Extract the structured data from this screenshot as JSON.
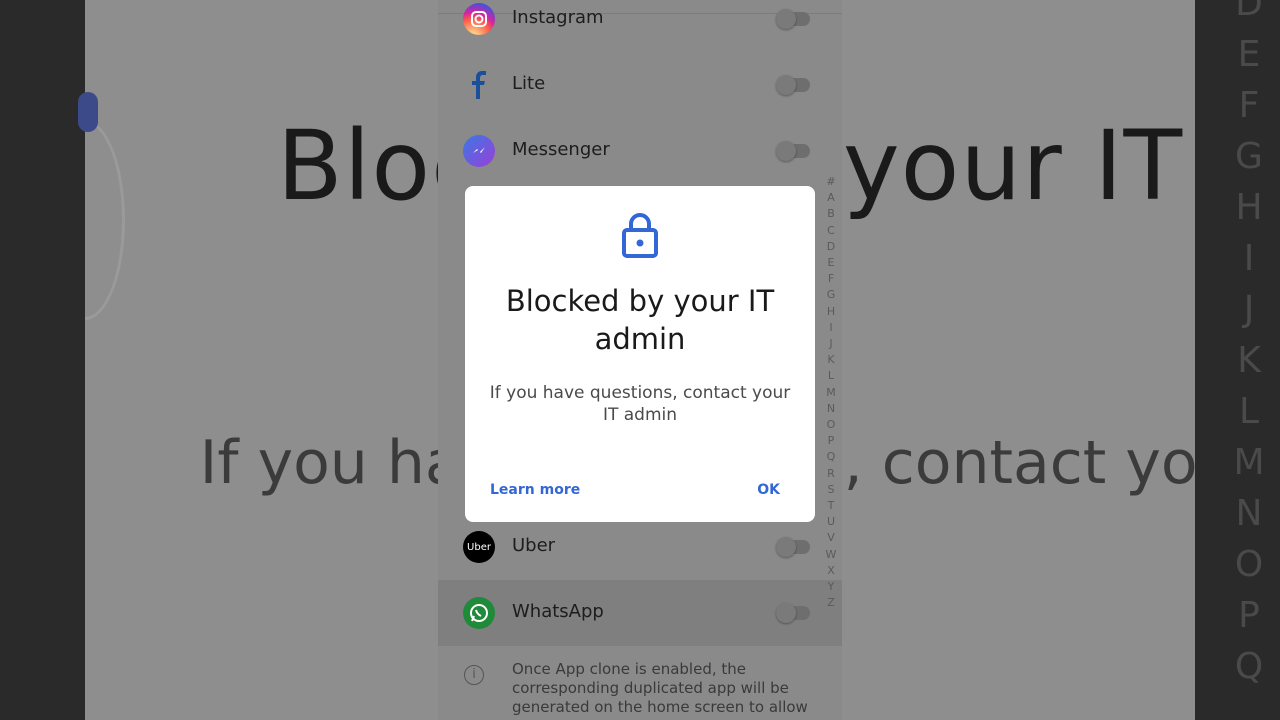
{
  "background": {
    "big_title": "Blocked by your IT",
    "big_message": "If you have questions, contact your",
    "alphabet": [
      "D",
      "E",
      "F",
      "G",
      "H",
      "I",
      "J",
      "K",
      "L",
      "M",
      "N",
      "O",
      "P",
      "Q"
    ]
  },
  "app_list": [
    {
      "label": "Instagram",
      "icon": "instagram-icon",
      "enabled": false
    },
    {
      "label": "Lite",
      "icon": "facebook-lite-icon",
      "enabled": false
    },
    {
      "label": "Messenger",
      "icon": "messenger-icon",
      "enabled": false
    },
    {
      "label": "Uber",
      "icon": "uber-icon",
      "enabled": false
    },
    {
      "label": "WhatsApp",
      "icon": "whatsapp-icon",
      "enabled": false
    }
  ],
  "info": {
    "icon": "info-icon",
    "text": "Once App clone is enabled, the corresponding duplicated app will be generated on the home screen to allow"
  },
  "index_bar": [
    "#",
    "A",
    "B",
    "C",
    "D",
    "E",
    "F",
    "G",
    "H",
    "I",
    "J",
    "K",
    "L",
    "M",
    "N",
    "O",
    "P",
    "Q",
    "R",
    "S",
    "T",
    "U",
    "V",
    "W",
    "X",
    "Y",
    "Z"
  ],
  "dialog": {
    "icon": "lock-icon",
    "title": "Blocked by your IT admin",
    "message": "If you have questions, contact your IT admin",
    "learn_more_label": "Learn more",
    "ok_label": "OK"
  },
  "colors": {
    "accent": "#3367d6",
    "scrim": "#8a8a8a",
    "dialog_bg": "#ffffff"
  }
}
